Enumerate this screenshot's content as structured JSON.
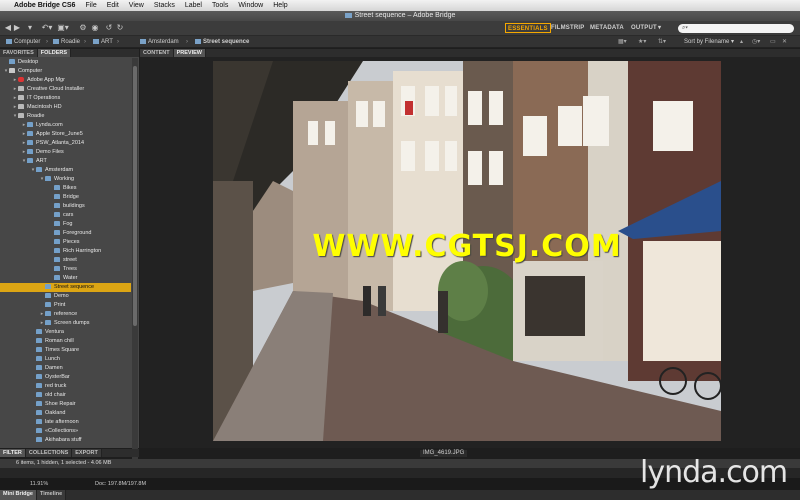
{
  "menubar": {
    "app_name": "Adobe Bridge CS6",
    "items": [
      "File",
      "Edit",
      "View",
      "Stacks",
      "Label",
      "Tools",
      "Window",
      "Help"
    ]
  },
  "window": {
    "title": "Street sequence – Adobe Bridge"
  },
  "toolbar": {
    "workspaces": [
      "ESSENTIALS",
      "FILMSTRIP",
      "METADATA",
      "OUTPUT"
    ],
    "active_workspace": "ESSENTIALS",
    "output_arrow": "▾",
    "sort_label": "Sort by Filename",
    "search_placeholder": "⌕▾"
  },
  "pathbar": {
    "crumbs": [
      "Computer",
      "Roadie",
      "ART",
      "Amsterdam",
      "Street sequence"
    ]
  },
  "left_panel": {
    "tabs": [
      "FAVORITES",
      "FOLDERS"
    ],
    "active_tab": "FOLDERS",
    "tree": [
      {
        "label": "Desktop",
        "depth": 0,
        "icon": "folder",
        "arrow": ""
      },
      {
        "label": "Computer",
        "depth": 0,
        "icon": "computer",
        "arrow": "▾"
      },
      {
        "label": "Adobe App Mgr",
        "depth": 1,
        "icon": "app",
        "arrow": "▸"
      },
      {
        "label": "Creative Cloud Installer",
        "depth": 1,
        "icon": "drive",
        "arrow": "▸"
      },
      {
        "label": "IT Operations",
        "depth": 1,
        "icon": "drive",
        "arrow": "▸"
      },
      {
        "label": "Macintosh HD",
        "depth": 1,
        "icon": "drive",
        "arrow": "▸"
      },
      {
        "label": "Roadie",
        "depth": 1,
        "icon": "drive",
        "arrow": "▾"
      },
      {
        "label": "Lynda.com",
        "depth": 2,
        "icon": "folder",
        "arrow": "▸"
      },
      {
        "label": "Apple Store_June5",
        "depth": 2,
        "icon": "folder",
        "arrow": "▸"
      },
      {
        "label": "PSW_Atlanta_2014",
        "depth": 2,
        "icon": "folder",
        "arrow": "▸"
      },
      {
        "label": "Demo Files",
        "depth": 2,
        "icon": "folder",
        "arrow": "▸"
      },
      {
        "label": "ART",
        "depth": 2,
        "icon": "folder",
        "arrow": "▾"
      },
      {
        "label": "Amsterdam",
        "depth": 3,
        "icon": "folder",
        "arrow": "▾"
      },
      {
        "label": "Working",
        "depth": 4,
        "icon": "folder",
        "arrow": "▾"
      },
      {
        "label": "Bikes",
        "depth": 5,
        "icon": "folder",
        "arrow": ""
      },
      {
        "label": "Bridge",
        "depth": 5,
        "icon": "folder",
        "arrow": ""
      },
      {
        "label": "buildings",
        "depth": 5,
        "icon": "folder",
        "arrow": ""
      },
      {
        "label": "cars",
        "depth": 5,
        "icon": "folder",
        "arrow": ""
      },
      {
        "label": "Fog",
        "depth": 5,
        "icon": "folder",
        "arrow": ""
      },
      {
        "label": "Foreground",
        "depth": 5,
        "icon": "folder",
        "arrow": ""
      },
      {
        "label": "Pieces",
        "depth": 5,
        "icon": "folder",
        "arrow": ""
      },
      {
        "label": "Rich Harrington",
        "depth": 5,
        "icon": "folder",
        "arrow": ""
      },
      {
        "label": "street",
        "depth": 5,
        "icon": "folder",
        "arrow": ""
      },
      {
        "label": "Trees",
        "depth": 5,
        "icon": "folder",
        "arrow": ""
      },
      {
        "label": "Water",
        "depth": 5,
        "icon": "folder",
        "arrow": ""
      },
      {
        "label": "Street sequence",
        "depth": 4,
        "icon": "folder",
        "arrow": "",
        "selected": true
      },
      {
        "label": "Demo",
        "depth": 4,
        "icon": "folder",
        "arrow": ""
      },
      {
        "label": "Print",
        "depth": 4,
        "icon": "folder",
        "arrow": ""
      },
      {
        "label": "reference",
        "depth": 4,
        "icon": "folder",
        "arrow": "▸"
      },
      {
        "label": "Screen dumps",
        "depth": 4,
        "icon": "folder",
        "arrow": "▸"
      },
      {
        "label": "Ventura",
        "depth": 3,
        "icon": "folder",
        "arrow": ""
      },
      {
        "label": "Roman chill",
        "depth": 3,
        "icon": "folder",
        "arrow": ""
      },
      {
        "label": "Times Square",
        "depth": 3,
        "icon": "folder",
        "arrow": ""
      },
      {
        "label": "Lunch",
        "depth": 3,
        "icon": "folder",
        "arrow": ""
      },
      {
        "label": "Damen",
        "depth": 3,
        "icon": "folder",
        "arrow": ""
      },
      {
        "label": "OysterBar",
        "depth": 3,
        "icon": "folder",
        "arrow": ""
      },
      {
        "label": "red truck",
        "depth": 3,
        "icon": "folder",
        "arrow": ""
      },
      {
        "label": "old chair",
        "depth": 3,
        "icon": "folder",
        "arrow": ""
      },
      {
        "label": "Shoe Repair",
        "depth": 3,
        "icon": "folder",
        "arrow": ""
      },
      {
        "label": "Oakland",
        "depth": 3,
        "icon": "folder",
        "arrow": ""
      },
      {
        "label": "late afternoon",
        "depth": 3,
        "icon": "folder",
        "arrow": ""
      },
      {
        "label": "«Collections»",
        "depth": 3,
        "icon": "folder",
        "arrow": ""
      },
      {
        "label": "Akihabara stuff",
        "depth": 3,
        "icon": "folder",
        "arrow": ""
      }
    ],
    "bottom_tabs": [
      "FILTER",
      "COLLECTIONS",
      "EXPORT"
    ]
  },
  "center": {
    "tabs": [
      "CONTENT",
      "PREVIEW"
    ],
    "active_tab": "PREVIEW",
    "filename": "IMG_4619.JPG",
    "overlay_text": "WWW.CGTSJ.COM"
  },
  "status": {
    "text": "6 items, 1 hidden, 1 selected - 4.06 MB"
  },
  "bottom": {
    "zoom": "11.91%",
    "doc": "Doc: 197.8M/197.8M",
    "tabs": [
      "Mini Bridge",
      "Timeline"
    ],
    "watermark": "lynda.com"
  },
  "colors": {
    "accent": "#f5a800",
    "selection": "#dca514",
    "folder": "#74a0c9"
  }
}
